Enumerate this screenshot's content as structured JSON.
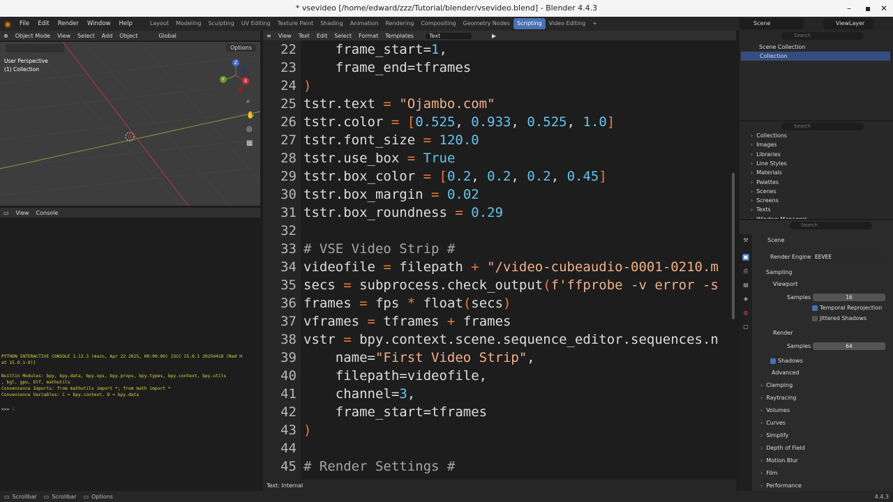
{
  "window": {
    "title": "* vsevideo [/home/edward/zzz/Tutorial/blender/vsevideo.blend] - Blender 4.4.3",
    "min_glyph": "–",
    "max_glyph": "▪",
    "close_glyph": "✕"
  },
  "menu": [
    "File",
    "Edit",
    "Render",
    "Window",
    "Help"
  ],
  "workspaces": [
    "Layout",
    "Modeling",
    "Sculpting",
    "UV Editing",
    "Texture Paint",
    "Shading",
    "Animation",
    "Rendering",
    "Compositing",
    "Geometry Nodes",
    "Scripting",
    "Video Editing"
  ],
  "active_workspace": "Scripting",
  "add_workspace": "+",
  "scene_field": "Scene",
  "viewlayer_field": "ViewLayer",
  "viewport": {
    "mode": "Object Mode",
    "menus": [
      "View",
      "Select",
      "Add",
      "Object"
    ],
    "transform": "Global",
    "options": "Options",
    "overlay1": "User Perspective",
    "overlay2": "(1) Collection",
    "axis_x": "X",
    "axis_y": "Y",
    "axis_z": "Z"
  },
  "console": {
    "menus": [
      "View",
      "Console"
    ],
    "lines": [
      "PYTHON INTERACTIVE CONSOLE 3.13.3 (main, Apr 22 2025, 00:00:00) [GCC 15.0.1 20250418 (Red H",
      "at 15.0.1-0)]",
      "",
      "Builtin Modules:       bpy, bpy.data, bpy.ops, bpy.props, bpy.types, bpy.context, bpy.utils",
      ", bgl, gpu, blf, mathutils",
      "Convenience Imports:   from mathutils import *; from math import *",
      "Convenience Variables: C = bpy.context, D = bpy.data",
      "",
      ">>> "
    ]
  },
  "text_editor": {
    "menus": [
      "View",
      "Text",
      "Edit",
      "Select",
      "Format",
      "Templates"
    ],
    "text_name": "Text",
    "status": "Text: Internal"
  },
  "code": [
    {
      "n": "22",
      "tokens": [
        [
          "    frame_start=",
          ""
        ],
        [
          "1",
          "num"
        ],
        [
          ",",
          ""
        ]
      ]
    },
    {
      "n": "23",
      "tokens": [
        [
          "    frame_end=tframes",
          ""
        ]
      ]
    },
    {
      "n": "24",
      "tokens": [
        [
          ")",
          "kw"
        ]
      ]
    },
    {
      "n": "25",
      "tokens": [
        [
          "tstr.text ",
          ""
        ],
        [
          "=",
          "op"
        ],
        [
          " ",
          ""
        ],
        [
          "\"Ojambo.com\"",
          "str"
        ]
      ]
    },
    {
      "n": "26",
      "tokens": [
        [
          "tstr.color ",
          ""
        ],
        [
          "=",
          "op"
        ],
        [
          " ",
          ""
        ],
        [
          "[",
          "kw"
        ],
        [
          "0.525",
          "num"
        ],
        [
          ", ",
          ""
        ],
        [
          "0.933",
          "num"
        ],
        [
          ", ",
          ""
        ],
        [
          "0.525",
          "num"
        ],
        [
          ", ",
          ""
        ],
        [
          "1.0",
          "num"
        ],
        [
          "]",
          "kw"
        ]
      ]
    },
    {
      "n": "27",
      "tokens": [
        [
          "tstr.font_size ",
          ""
        ],
        [
          "=",
          "op"
        ],
        [
          " ",
          ""
        ],
        [
          "120.0",
          "num"
        ]
      ]
    },
    {
      "n": "28",
      "tokens": [
        [
          "tstr.use_box ",
          ""
        ],
        [
          "=",
          "op"
        ],
        [
          " ",
          ""
        ],
        [
          "True",
          "num"
        ]
      ]
    },
    {
      "n": "29",
      "tokens": [
        [
          "tstr.box_color ",
          ""
        ],
        [
          "=",
          "op"
        ],
        [
          " ",
          ""
        ],
        [
          "[",
          "kw"
        ],
        [
          "0.2",
          "num"
        ],
        [
          ", ",
          ""
        ],
        [
          "0.2",
          "num"
        ],
        [
          ", ",
          ""
        ],
        [
          "0.2",
          "num"
        ],
        [
          ", ",
          ""
        ],
        [
          "0.45",
          "num"
        ],
        [
          "]",
          "kw"
        ]
      ]
    },
    {
      "n": "30",
      "tokens": [
        [
          "tstr.box_margin ",
          ""
        ],
        [
          "=",
          "op"
        ],
        [
          " ",
          ""
        ],
        [
          "0.02",
          "num"
        ]
      ]
    },
    {
      "n": "31",
      "tokens": [
        [
          "tstr.box_roundness ",
          ""
        ],
        [
          "=",
          "op"
        ],
        [
          " ",
          ""
        ],
        [
          "0.29",
          "num"
        ]
      ]
    },
    {
      "n": "32",
      "tokens": [
        [
          "",
          ""
        ]
      ]
    },
    {
      "n": "33",
      "tokens": [
        [
          "# VSE Video Strip #",
          "cm"
        ]
      ]
    },
    {
      "n": "34",
      "tokens": [
        [
          "videofile ",
          ""
        ],
        [
          "=",
          "op"
        ],
        [
          " filepath ",
          ""
        ],
        [
          "+",
          "op"
        ],
        [
          " ",
          ""
        ],
        [
          "\"/video-cubeaudio-0001-0210.m",
          "str"
        ]
      ]
    },
    {
      "n": "35",
      "tokens": [
        [
          "secs ",
          ""
        ],
        [
          "=",
          "op"
        ],
        [
          " subprocess.check_output",
          ""
        ],
        [
          "(",
          "kw"
        ],
        [
          "f'ffprobe -v error -s",
          "str"
        ]
      ]
    },
    {
      "n": "36",
      "tokens": [
        [
          "frames ",
          ""
        ],
        [
          "=",
          "op"
        ],
        [
          " fps ",
          ""
        ],
        [
          "*",
          "op"
        ],
        [
          " float",
          ""
        ],
        [
          "(",
          "kw"
        ],
        [
          "secs",
          ""
        ],
        [
          ")",
          "kw"
        ]
      ]
    },
    {
      "n": "37",
      "tokens": [
        [
          "vframes ",
          ""
        ],
        [
          "=",
          "op"
        ],
        [
          " tframes ",
          ""
        ],
        [
          "+",
          "op"
        ],
        [
          " frames",
          ""
        ]
      ]
    },
    {
      "n": "38",
      "tokens": [
        [
          "vstr ",
          ""
        ],
        [
          "=",
          "op"
        ],
        [
          " bpy.context.scene.sequence_editor.sequences.n",
          ""
        ]
      ]
    },
    {
      "n": "39",
      "tokens": [
        [
          "    name=",
          ""
        ],
        [
          "\"First Video Strip\"",
          "str"
        ],
        [
          ",",
          ""
        ]
      ]
    },
    {
      "n": "40",
      "tokens": [
        [
          "    filepath=videofile,",
          ""
        ]
      ]
    },
    {
      "n": "41",
      "tokens": [
        [
          "    channel=",
          ""
        ],
        [
          "3",
          "num"
        ],
        [
          ",",
          ""
        ]
      ]
    },
    {
      "n": "42",
      "tokens": [
        [
          "    frame_start=tframes",
          ""
        ]
      ]
    },
    {
      "n": "43",
      "tokens": [
        [
          ")",
          "kw"
        ]
      ]
    },
    {
      "n": "44",
      "tokens": [
        [
          "",
          ""
        ]
      ]
    },
    {
      "n": "45",
      "tokens": [
        [
          "# Render Settings #",
          "cm"
        ]
      ]
    }
  ],
  "outliner": {
    "search_placeholder": "Search",
    "scene_collection": "Scene Collection",
    "collection": "Collection"
  },
  "datablocks": {
    "search_placeholder": "Search",
    "items": [
      "Collections",
      "Images",
      "Libraries",
      "Line Styles",
      "Materials",
      "Palettes",
      "Scenes",
      "Screens",
      "Texts",
      "Window Managers"
    ]
  },
  "properties": {
    "search_placeholder": "Search",
    "context": "Scene",
    "render_engine_label": "Render Engine",
    "render_engine": "EEVEE",
    "sampling": "Sampling",
    "viewport": "Viewport",
    "samples_label": "Samples",
    "viewport_samples": "16",
    "temporal_reprojection": "Temporal Reprojection",
    "jittered_shadows": "Jittered Shadows",
    "render": "Render",
    "render_samples": "64",
    "shadows": "Shadows",
    "advanced": "Advanced",
    "panels": [
      "Clamping",
      "Raytracing",
      "Volumes",
      "Curves",
      "Simplify",
      "Depth of Field",
      "Motion Blur",
      "Film",
      "Performance"
    ]
  },
  "statusbar": {
    "items": [
      "Scrollbar",
      "Scrollbar",
      "Options"
    ],
    "version": "4.4.3"
  },
  "colors": {
    "accent": "#4772b3",
    "console_text": "#d5db44",
    "string": "#f2b08a",
    "number": "#65c4ee",
    "keyword": "#e87d3e"
  }
}
